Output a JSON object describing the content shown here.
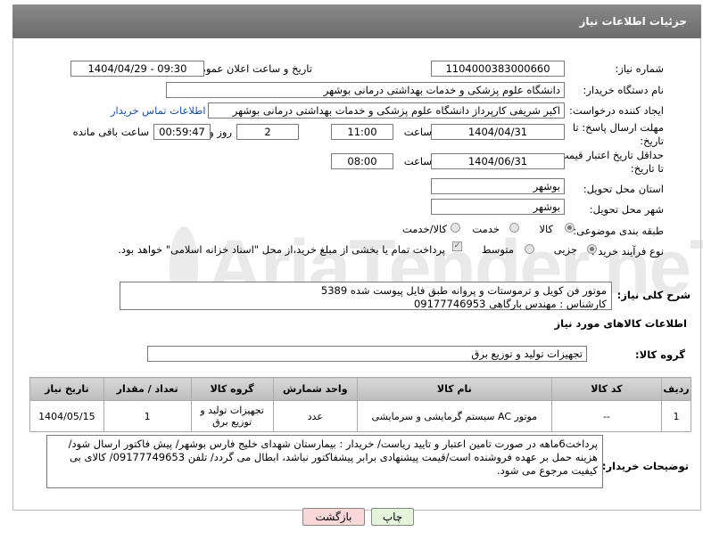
{
  "header": {
    "title": "جزئیات اطلاعات نیاز"
  },
  "fields": {
    "need_number_label": "شماره نیاز:",
    "need_number": "1104000383000660",
    "announce_label": "تاریخ و ساعت اعلان عمومی:",
    "announce_value": "1404/04/29 - 09:30",
    "buyer_org_label": "نام دستگاه خریدار:",
    "buyer_org": "دانشگاه علوم پزشکی و خدمات بهداشتی درمانی بوشهر",
    "creator_label": "ایجاد کننده درخواست:",
    "creator": "اکبر شریفی کارپرداز دانشگاه علوم پزشکی و خدمات بهداشتی درمانی بوشهر",
    "contact_link": "اطلاعات تماس خریدار",
    "deadline_label_1": "مهلت ارسال پاسخ: تا",
    "deadline_label_2": "تاریخ:",
    "deadline_date": "1404/04/31",
    "time_label": "ساعت",
    "deadline_time": "11:00",
    "days_value": "2",
    "days_label": "روز و",
    "remaining_time": "00:59:47",
    "remaining_label": "ساعت باقی مانده",
    "validity_label_1": "حداقل تاریخ اعتبار قیمت:",
    "validity_label_2": "تا تاریخ:",
    "validity_date": "1404/06/31",
    "validity_time": "08:00",
    "province_label": "استان محل تحویل:",
    "province": "بوشهر",
    "city_label": "شهر محل تحویل:",
    "city": "بوشهر",
    "category_label": "طبقه بندی موضوعی:",
    "category_options": [
      "کالا",
      "خدمت",
      "کالا/خدمت"
    ],
    "process_label": "نوع فرآیند خرید :",
    "process_options": [
      "جزیی",
      "متوسط"
    ],
    "payment_note": "پرداخت تمام یا بخشی از مبلغ خرید،از محل \"اسناد خزانه اسلامی\" خواهد بود."
  },
  "description": {
    "label": "شرح کلی نیاز:",
    "line1": "موتور فن کویل و ترموستات و پروانه طبق فایل پیوست شده 5389",
    "line2": "کارشناس : مهندس بارگاهی 09177746953"
  },
  "goods_section": {
    "title": "اطلاعات کالاهای مورد نیاز",
    "group_label": "گروه کالا:",
    "group_value": "تجهیزات تولید و توزیع برق"
  },
  "table": {
    "headers": [
      "ردیف",
      "کد کالا",
      "نام کالا",
      "واحد شمارش",
      "گروه کالا",
      "تعداد / مقدار",
      "تاریخ نیاز"
    ],
    "rows": [
      [
        "1",
        "--",
        "موتور AC سیستم گرمایشی و سرمایشی",
        "عدد",
        "تجهیزات تولید و توزیع برق",
        "1",
        "1404/05/15"
      ]
    ]
  },
  "buyer_notes": {
    "label": "توضیحات خریدار:",
    "text": "پرداخت6ماهه در صورت تامین اعتبار و تایید ریاست/ خریدار : بیمارستان شهدای خلیج فارس بوشهر/ پیش فاکتور ارسال شود/ هزینه حمل بر عهده فروشنده است/قیمت پیشنهادی برابر پیشفاکتور نباشد، ابطال می گردد/ تلفن 09177749653/ کالای بی کیفیت مرجوع می شود."
  },
  "buttons": {
    "print": "چاپ",
    "back": "بازگشت"
  },
  "colors": {
    "header_bg": "#7a7a7a",
    "link": "#1a4fa0",
    "back_btn_bg": "#f7d7d7",
    "print_btn_bg": "#e4f5dc"
  }
}
